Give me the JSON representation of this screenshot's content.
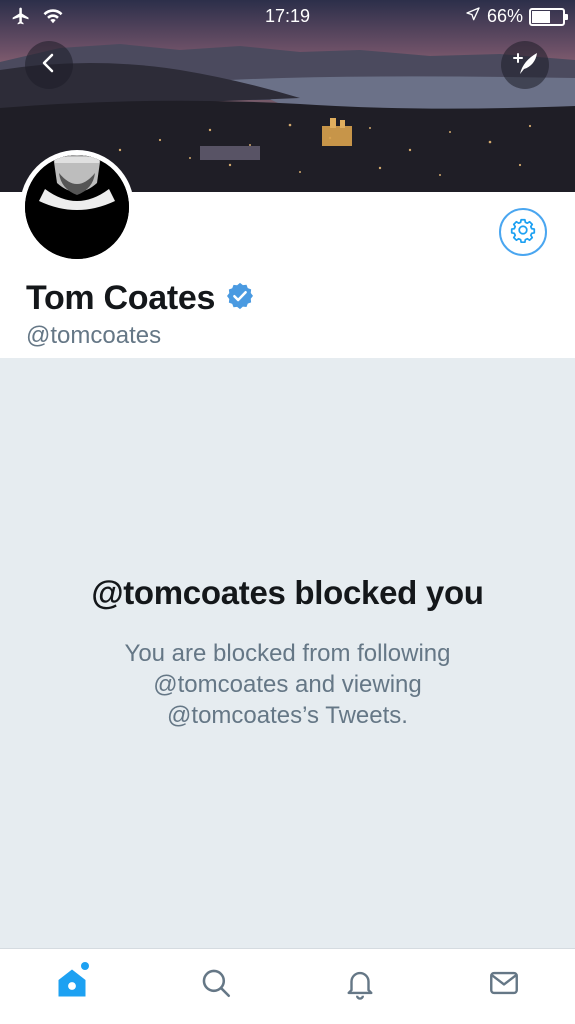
{
  "status_bar": {
    "time": "17:19",
    "battery": "66%",
    "battery_level": 0.66
  },
  "profile": {
    "name": "Tom Coates",
    "handle": "@tomcoates",
    "verified": true,
    "verified_color": "#4a9ae1"
  },
  "blocked_notice": {
    "title": "@tomcoates blocked you",
    "message": "You are blocked from following @tomcoates and viewing @tomcoates’s Tweets."
  },
  "colors": {
    "accent": "#1da1f2",
    "text_primary": "#14171a",
    "text_secondary": "#657786",
    "background": "#e6ecf0"
  },
  "tab_bar": {
    "items": [
      {
        "name": "Home",
        "icon": "home-icon",
        "active": true
      },
      {
        "name": "Search",
        "icon": "search-icon",
        "active": false
      },
      {
        "name": "Notifications",
        "icon": "bell-icon",
        "active": false
      },
      {
        "name": "Messages",
        "icon": "envelope-icon",
        "active": false
      }
    ]
  }
}
